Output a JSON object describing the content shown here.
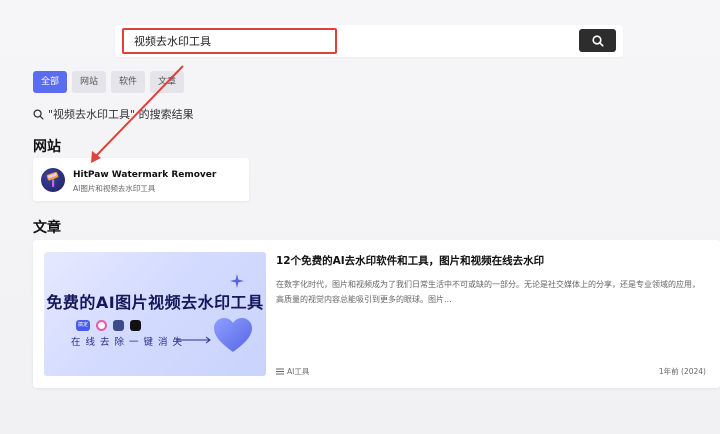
{
  "search": {
    "query": "视频去水印工具",
    "button_icon": "search-icon"
  },
  "tabs": [
    {
      "label": "全部",
      "active": true
    },
    {
      "label": "网站",
      "active": false
    },
    {
      "label": "软件",
      "active": false
    },
    {
      "label": "文章",
      "active": false
    }
  ],
  "results_caption": "\"视频去水印工具\" 的搜索结果",
  "sections": {
    "websites_title": "网站",
    "articles_title": "文章"
  },
  "website": {
    "name": "HitPaw Watermark Remover",
    "description": "AI图片和视频去水印工具",
    "logo_icon": "paint-roller-icon"
  },
  "article": {
    "title": "12个免费的AI去水印软件和工具，图片和视频在线去水印",
    "summary": "在数字化时代，图片和视频成为了我们日常生活中不可或缺的一部分。无论是社交媒体上的分享，还是专业领域的应用，高质量的视觉内容总能吸引到更多的眼球。图片...",
    "category": "AI工具",
    "category_icon": "list-icon",
    "date": "1年前 (2024)",
    "thumbnail": {
      "title": "免费的AI图片视频去水印工具",
      "subtitle": "在线去除一键消失",
      "badge_text": "搞定"
    }
  },
  "colors": {
    "accent": "#5a6cf0",
    "annotation_red": "#e0413a",
    "search_button": "#2d2d2d"
  }
}
